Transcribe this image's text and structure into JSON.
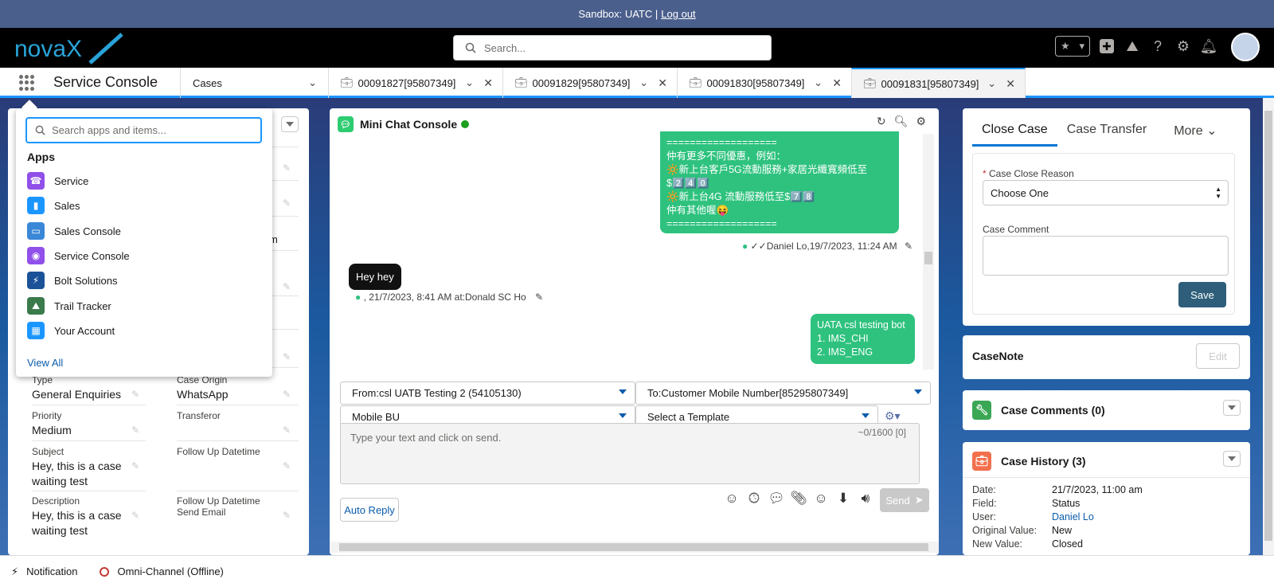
{
  "sandbox": {
    "text": "Sandbox: UATC |",
    "logout": "Log out"
  },
  "header": {
    "logo_text": "novaX",
    "search_placeholder": "Search..."
  },
  "nav": {
    "app_name": "Service Console",
    "object_select": "Cases",
    "tabs": [
      {
        "label": "00091827[95807349]"
      },
      {
        "label": "00091829[95807349]"
      },
      {
        "label": "00091830[95807349]"
      },
      {
        "label": "00091831[95807349]"
      }
    ]
  },
  "app_launcher": {
    "search_placeholder": "Search apps and items...",
    "title": "Apps",
    "items": [
      {
        "label": "Service",
        "color": "#9050e9"
      },
      {
        "label": "Sales",
        "color": "#1b96ff"
      },
      {
        "label": "Sales Console",
        "color": "#3a87d8"
      },
      {
        "label": "Service Console",
        "color": "#9050e9"
      },
      {
        "label": "Bolt Solutions",
        "color": "#1b5297"
      },
      {
        "label": "Trail Tracker",
        "color": "#3b7a4b"
      },
      {
        "label": "Your Account",
        "color": "#1b96ff"
      }
    ],
    "view_all": "View All"
  },
  "case_fields": {
    "type_label": "Type",
    "type_value": "General Enquiries",
    "origin_label": "Case Origin",
    "origin_value": "WhatsApp",
    "priority_label": "Priority",
    "priority_value": "Medium",
    "transferor_label": "Transferor",
    "transferor_value": "",
    "subject_label": "Subject",
    "subject_value": "Hey, this is a case waiting test",
    "followup_label": "Follow Up Datetime",
    "followup_value": "",
    "description_label": "Description",
    "description_value": "Hey, this is a case waiting test",
    "followup_email_label": "Follow Up Datetime Send Email",
    "partial_m": "m"
  },
  "chat": {
    "title": "Mini Chat Console",
    "bot_message_lines": [
      "===================",
      "仲有更多不同優惠，例如：",
      "🔆新上台客戶5G流動服務+家居光纖寬頻低至",
      "$2️⃣4️⃣0️⃣",
      "🔆新上台4G 流動服務低至$7️⃣8️⃣",
      "仲有其他喔😝",
      "==================="
    ],
    "bot_meta": "✓✓Daniel Lo,19/7/2023, 11:24 AM",
    "in_message": "Hey hey",
    "in_meta": ", 21/7/2023, 8:41 AM at:Donald SC Ho",
    "out_message_lines": [
      "UATA csl testing bot",
      "1. IMS_CHI",
      "2. IMS_ENG"
    ],
    "from_select": "From:csl UATB Testing 2 (54105130)",
    "to_select": "To:Customer Mobile Number[85295807349]",
    "bu_select": "Mobile BU",
    "template_select": "Select a Template",
    "input_placeholder": "Type your text and click on send.",
    "counter": "~0/1600 [0]",
    "auto_reply": "Auto Reply",
    "send": "Send"
  },
  "close_case": {
    "tabs": [
      "Close Case",
      "Case Transfer",
      "More"
    ],
    "reason_label": "Case Close Reason",
    "reason_value": "Choose One",
    "comment_label": "Case Comment",
    "save": "Save"
  },
  "case_note": {
    "title": "CaseNote",
    "edit": "Edit"
  },
  "case_comments": {
    "title": "Case Comments (0)"
  },
  "case_history": {
    "title": "Case History (3)",
    "rows": [
      {
        "k": "Date:",
        "v": "21/7/2023, 11:00 am"
      },
      {
        "k": "Field:",
        "v": "Status"
      },
      {
        "k": "User:",
        "v": "Daniel Lo"
      },
      {
        "k": "Original Value:",
        "v": "New"
      },
      {
        "k": "New Value:",
        "v": "Closed"
      }
    ]
  },
  "footer": {
    "notification": "Notification",
    "omni": "Omni-Channel (Offline)"
  }
}
